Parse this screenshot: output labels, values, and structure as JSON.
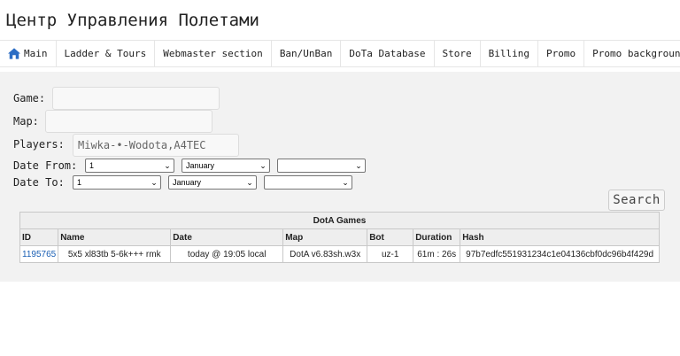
{
  "header": {
    "title": "Центр Управления Полетами"
  },
  "nav": {
    "items": [
      {
        "label": "Main",
        "icon": "home-icon"
      },
      {
        "label": "Ladder & Tours"
      },
      {
        "label": "Webmaster section"
      },
      {
        "label": "Ban/UnBan"
      },
      {
        "label": "DoTa Database"
      },
      {
        "label": "Store"
      },
      {
        "label": "Billing"
      },
      {
        "label": "Promo"
      },
      {
        "label": "Promo background"
      }
    ]
  },
  "form": {
    "game_label": "Game:",
    "game_value": "",
    "map_label": "Map:",
    "map_value": "",
    "players_label": "Players:",
    "players_value": "Miwka-•-Wodota,A4TEC",
    "date_from_label": "Date From:",
    "date_from": {
      "day": "1",
      "month": "January",
      "year": ""
    },
    "date_to_label": "Date To:",
    "date_to": {
      "day": "1",
      "month": "January",
      "year": ""
    },
    "search_label": "Search"
  },
  "games_table": {
    "caption": "DotA Games",
    "columns": [
      "ID",
      "Name",
      "Date",
      "Map",
      "Bot",
      "Duration",
      "Hash"
    ],
    "rows": [
      {
        "id": "1195765",
        "name": "5x5 xl83tb 5-6k+++ rmk",
        "date": "today @ 19:05 local",
        "map": "DotA v6.83sh.w3x",
        "bot": "uz-1",
        "duration": "61m : 26s",
        "hash": "97b7edfc551931234c1e04136cbf0dc96b4f429d"
      }
    ]
  },
  "colors": {
    "panel_bg": "#f2f2f2",
    "link": "#1a5fb4",
    "home_icon": "#2a6cc4"
  }
}
